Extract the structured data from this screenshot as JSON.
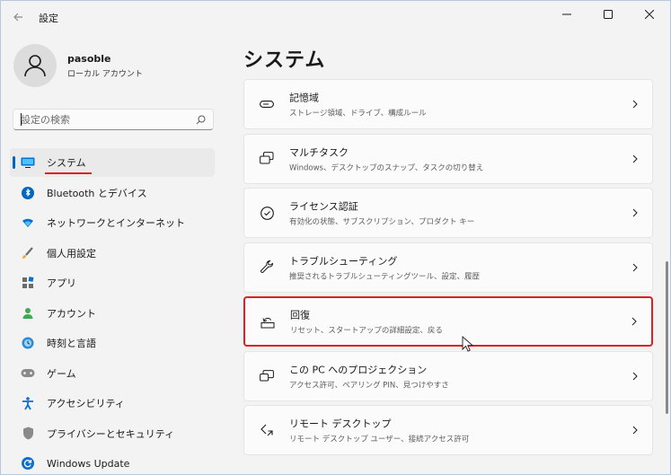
{
  "window": {
    "title": "設定",
    "controls": {
      "minimize": "—",
      "maximize": "☐",
      "close": "✕"
    }
  },
  "profile": {
    "name": "pasoble",
    "account_type": "ローカル アカウント"
  },
  "search": {
    "placeholder": "設定の検索"
  },
  "sidebar": {
    "items": [
      {
        "label": "システム",
        "icon": "system-icon",
        "active": true
      },
      {
        "label": "Bluetooth とデバイス",
        "icon": "bluetooth-icon"
      },
      {
        "label": "ネットワークとインターネット",
        "icon": "network-icon"
      },
      {
        "label": "個人用設定",
        "icon": "personalization-icon"
      },
      {
        "label": "アプリ",
        "icon": "apps-icon"
      },
      {
        "label": "アカウント",
        "icon": "accounts-icon"
      },
      {
        "label": "時刻と言語",
        "icon": "time-language-icon"
      },
      {
        "label": "ゲーム",
        "icon": "gaming-icon"
      },
      {
        "label": "アクセシビリティ",
        "icon": "accessibility-icon"
      },
      {
        "label": "プライバシーとセキュリティ",
        "icon": "privacy-icon"
      },
      {
        "label": "Windows Update",
        "icon": "windows-update-icon"
      }
    ]
  },
  "main": {
    "title": "システム",
    "items": [
      {
        "title": "記憶域",
        "subtitle": "ストレージ領域、ドライブ、構成ルール",
        "icon": "storage-icon"
      },
      {
        "title": "マルチタスク",
        "subtitle": "Windows、デスクトップのスナップ、タスクの切り替え",
        "icon": "multitasking-icon"
      },
      {
        "title": "ライセンス認証",
        "subtitle": "有効化の状態、サブスクリプション、プロダクト キー",
        "icon": "activation-icon"
      },
      {
        "title": "トラブルシューティング",
        "subtitle": "推奨されるトラブルシューティングツール、設定、履歴",
        "icon": "troubleshoot-icon"
      },
      {
        "title": "回復",
        "subtitle": "リセット、スタートアップの詳細設定、戻る",
        "icon": "recovery-icon",
        "highlighted": true
      },
      {
        "title": "この PC へのプロジェクション",
        "subtitle": "アクセス許可、ペアリング PIN、見つけやすさ",
        "icon": "projection-icon"
      },
      {
        "title": "リモート デスクトップ",
        "subtitle": "リモート デスクトップ ユーザー、接続アクセス許可",
        "icon": "remote-desktop-icon"
      }
    ]
  },
  "colors": {
    "accent": "#0067c0",
    "highlight": "#e02020"
  }
}
